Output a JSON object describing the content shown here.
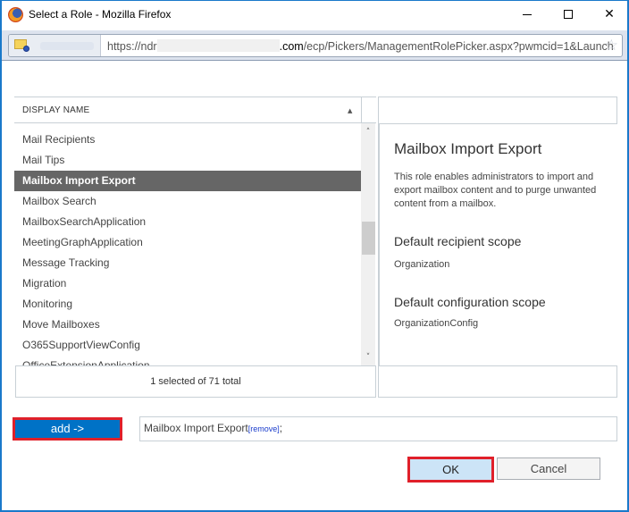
{
  "window": {
    "title": "Select a Role - Mozilla Firefox",
    "controls": {
      "minimize": "minimize",
      "maximize": "maximize",
      "close": "✕"
    }
  },
  "urlbar": {
    "prefix": "https://ndr",
    "domain_suffix": ".com",
    "path": "/ecp/Pickers/ManagementRolePicker.aspx?pwmcid=1&Launch",
    "star": "☆"
  },
  "list": {
    "column_header": "DISPLAY NAME",
    "sort_indicator": "▲",
    "items": [
      {
        "label": "Mail Recipients",
        "selected": false
      },
      {
        "label": "Mail Tips",
        "selected": false
      },
      {
        "label": "Mailbox Import Export",
        "selected": true
      },
      {
        "label": "Mailbox Search",
        "selected": false
      },
      {
        "label": "MailboxSearchApplication",
        "selected": false
      },
      {
        "label": "MeetingGraphApplication",
        "selected": false
      },
      {
        "label": "Message Tracking",
        "selected": false
      },
      {
        "label": "Migration",
        "selected": false
      },
      {
        "label": "Monitoring",
        "selected": false
      },
      {
        "label": "Move Mailboxes",
        "selected": false
      },
      {
        "label": "O365SupportViewConfig",
        "selected": false
      },
      {
        "label": "OfficeExtensionApplication",
        "selected": false
      }
    ],
    "scroll_up": "˄",
    "scroll_down": "˅",
    "footer_status": "1 selected of 71 total"
  },
  "detail": {
    "title": "Mailbox Import Export",
    "description": "This role enables administrators to import and export mailbox content and to purge unwanted content from a mailbox.",
    "recipient_scope_label": "Default recipient scope",
    "recipient_scope_value": "Organization",
    "config_scope_label": "Default configuration scope",
    "config_scope_value": "OrganizationConfig"
  },
  "add_row": {
    "add_button": "add ->",
    "selected_value": "Mailbox Import Export",
    "remove_link": "[remove]",
    "separator": ";"
  },
  "actions": {
    "ok": "OK",
    "cancel": "Cancel"
  },
  "colors": {
    "accent": "#0072c6",
    "selection": "#666666",
    "highlight_border": "#e0202a",
    "ok_background": "#cce4f7"
  }
}
